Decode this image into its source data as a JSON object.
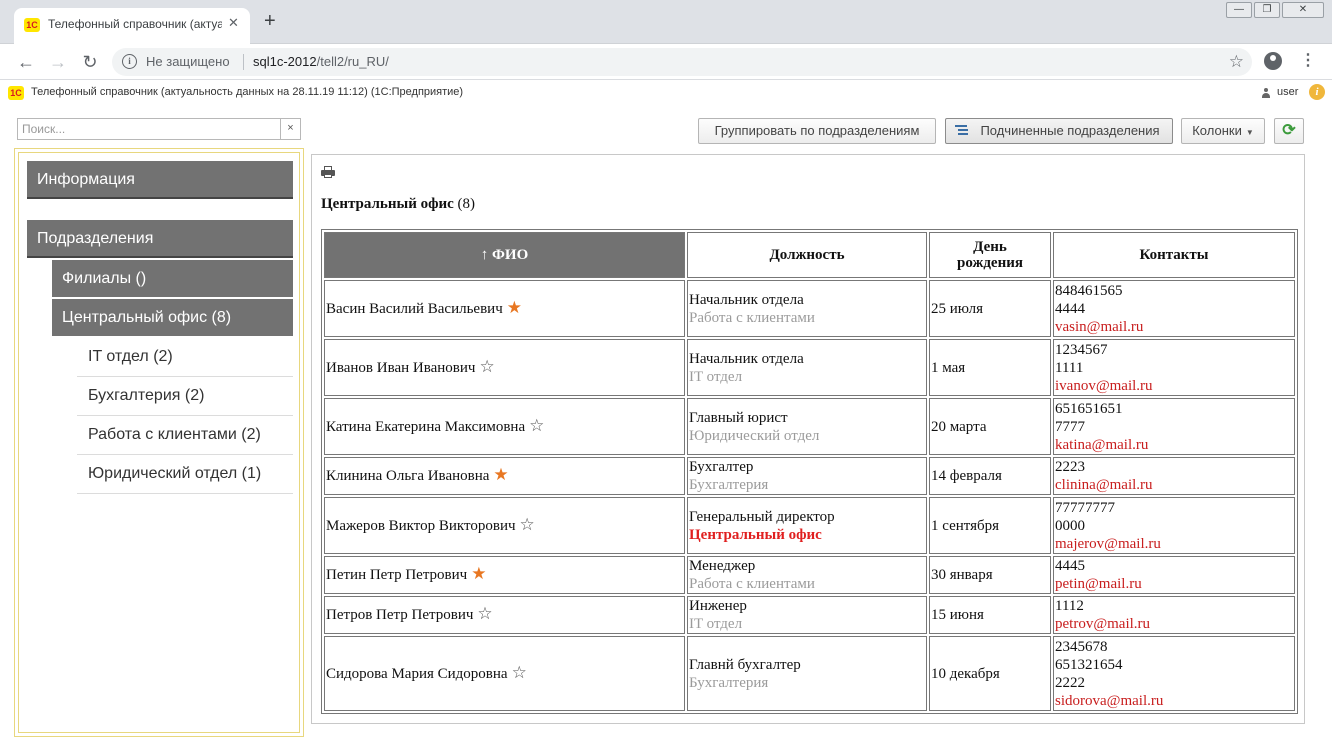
{
  "browser": {
    "tab_title": "Телефонный справочник (актуа",
    "tab_logo": "1С",
    "new_tab": "+",
    "security_label": "Не защищено",
    "url_host": "sql1c-2012",
    "url_path": "/tell2/ru_RU/",
    "win_minimize": "—",
    "win_restore": "❐",
    "win_close": "✕"
  },
  "app": {
    "logo": "1С",
    "title": "Телефонный справочник (актуальность данных на 28.11.19 11:12)   (1С:Предприятие)",
    "user": "user",
    "info_badge": "i"
  },
  "search": {
    "placeholder": "Поиск...",
    "clear": "×"
  },
  "nav": {
    "info": "Информация",
    "divisions": "Подразделения",
    "branches": "Филиалы ()",
    "central": "Центральный офис (8)",
    "leaves": [
      "IT отдел (2)",
      "Бухгалтерия (2)",
      "Работа с клиентами (2)",
      "Юридический отдел (1)"
    ]
  },
  "actions": {
    "group": "Группировать по подразделениям",
    "subordinate": "Подчиненные подразделения",
    "columns": "Колонки",
    "columns_caret": "▼",
    "refresh": "⟳"
  },
  "content": {
    "title": "Центральный офис",
    "count": "(8)",
    "headers": {
      "name": "↑ ФИО",
      "position": "Должность",
      "birthday_1": "День",
      "birthday_2": "рождения",
      "contacts": "Контакты"
    },
    "rows": [
      {
        "name": "Васин Василий Васильевич",
        "fav": "★",
        "position": "Начальник отдела",
        "dept": "Работа с клиентами",
        "birthday": "25 июля",
        "phone1": "848461565",
        "phone2": "4444",
        "email": "vasin@mail.ru"
      },
      {
        "name": "Иванов Иван Иванович",
        "fav": "☆",
        "position": "Начальник отдела",
        "dept": "IT отдел",
        "birthday": "1 мая",
        "phone1": "1234567",
        "phone2": "1111",
        "email": "ivanov@mail.ru"
      },
      {
        "name": "Катина Екатерина Максимовна",
        "fav": "☆",
        "position": "Главный юрист",
        "dept": "Юридический отдел",
        "birthday": "20 марта",
        "phone1": "651651651",
        "phone2": "7777",
        "email": "katina@mail.ru"
      },
      {
        "name": "Клинина Ольга Ивановна",
        "fav": "★",
        "position": "Бухгалтер",
        "dept": "Бухгалтерия",
        "birthday": "14 февраля",
        "phone1": "2223",
        "email": "clinina@mail.ru"
      },
      {
        "name": "Мажеров Виктор Викторович",
        "fav": "☆",
        "position": "Генеральный директор",
        "dept": "Центральный офис",
        "birthday": "1 сентября",
        "phone1": "77777777",
        "phone2": "0000",
        "email": "majerov@mail.ru"
      },
      {
        "name": "Петин Петр Петрович",
        "fav": "★",
        "position": "Менеджер",
        "dept": "Работа с клиентами",
        "birthday": "30 января",
        "phone1": "4445",
        "email": "petin@mail.ru"
      },
      {
        "name": "Петров Петр Петрович",
        "fav": "☆",
        "position": "Инженер",
        "dept": "IT отдел",
        "birthday": "15 июня",
        "phone1": "1112",
        "email": "petrov@mail.ru"
      },
      {
        "name": "Сидорова Мария Сидоровна",
        "fav": "☆",
        "position": "Главнй бухгалтер",
        "dept": "Бухгалтерия",
        "birthday": "10 декабря",
        "phone1": "2345678",
        "phone2": "651321654",
        "phone3": "2222",
        "email": "sidorova@mail.ru"
      }
    ]
  },
  "colors": {
    "nav_bg": "#727272",
    "favorite": "#e87722",
    "email": "#c81e1e",
    "dept_highlight": "#e02020",
    "panel_border": "#e8d77e"
  }
}
